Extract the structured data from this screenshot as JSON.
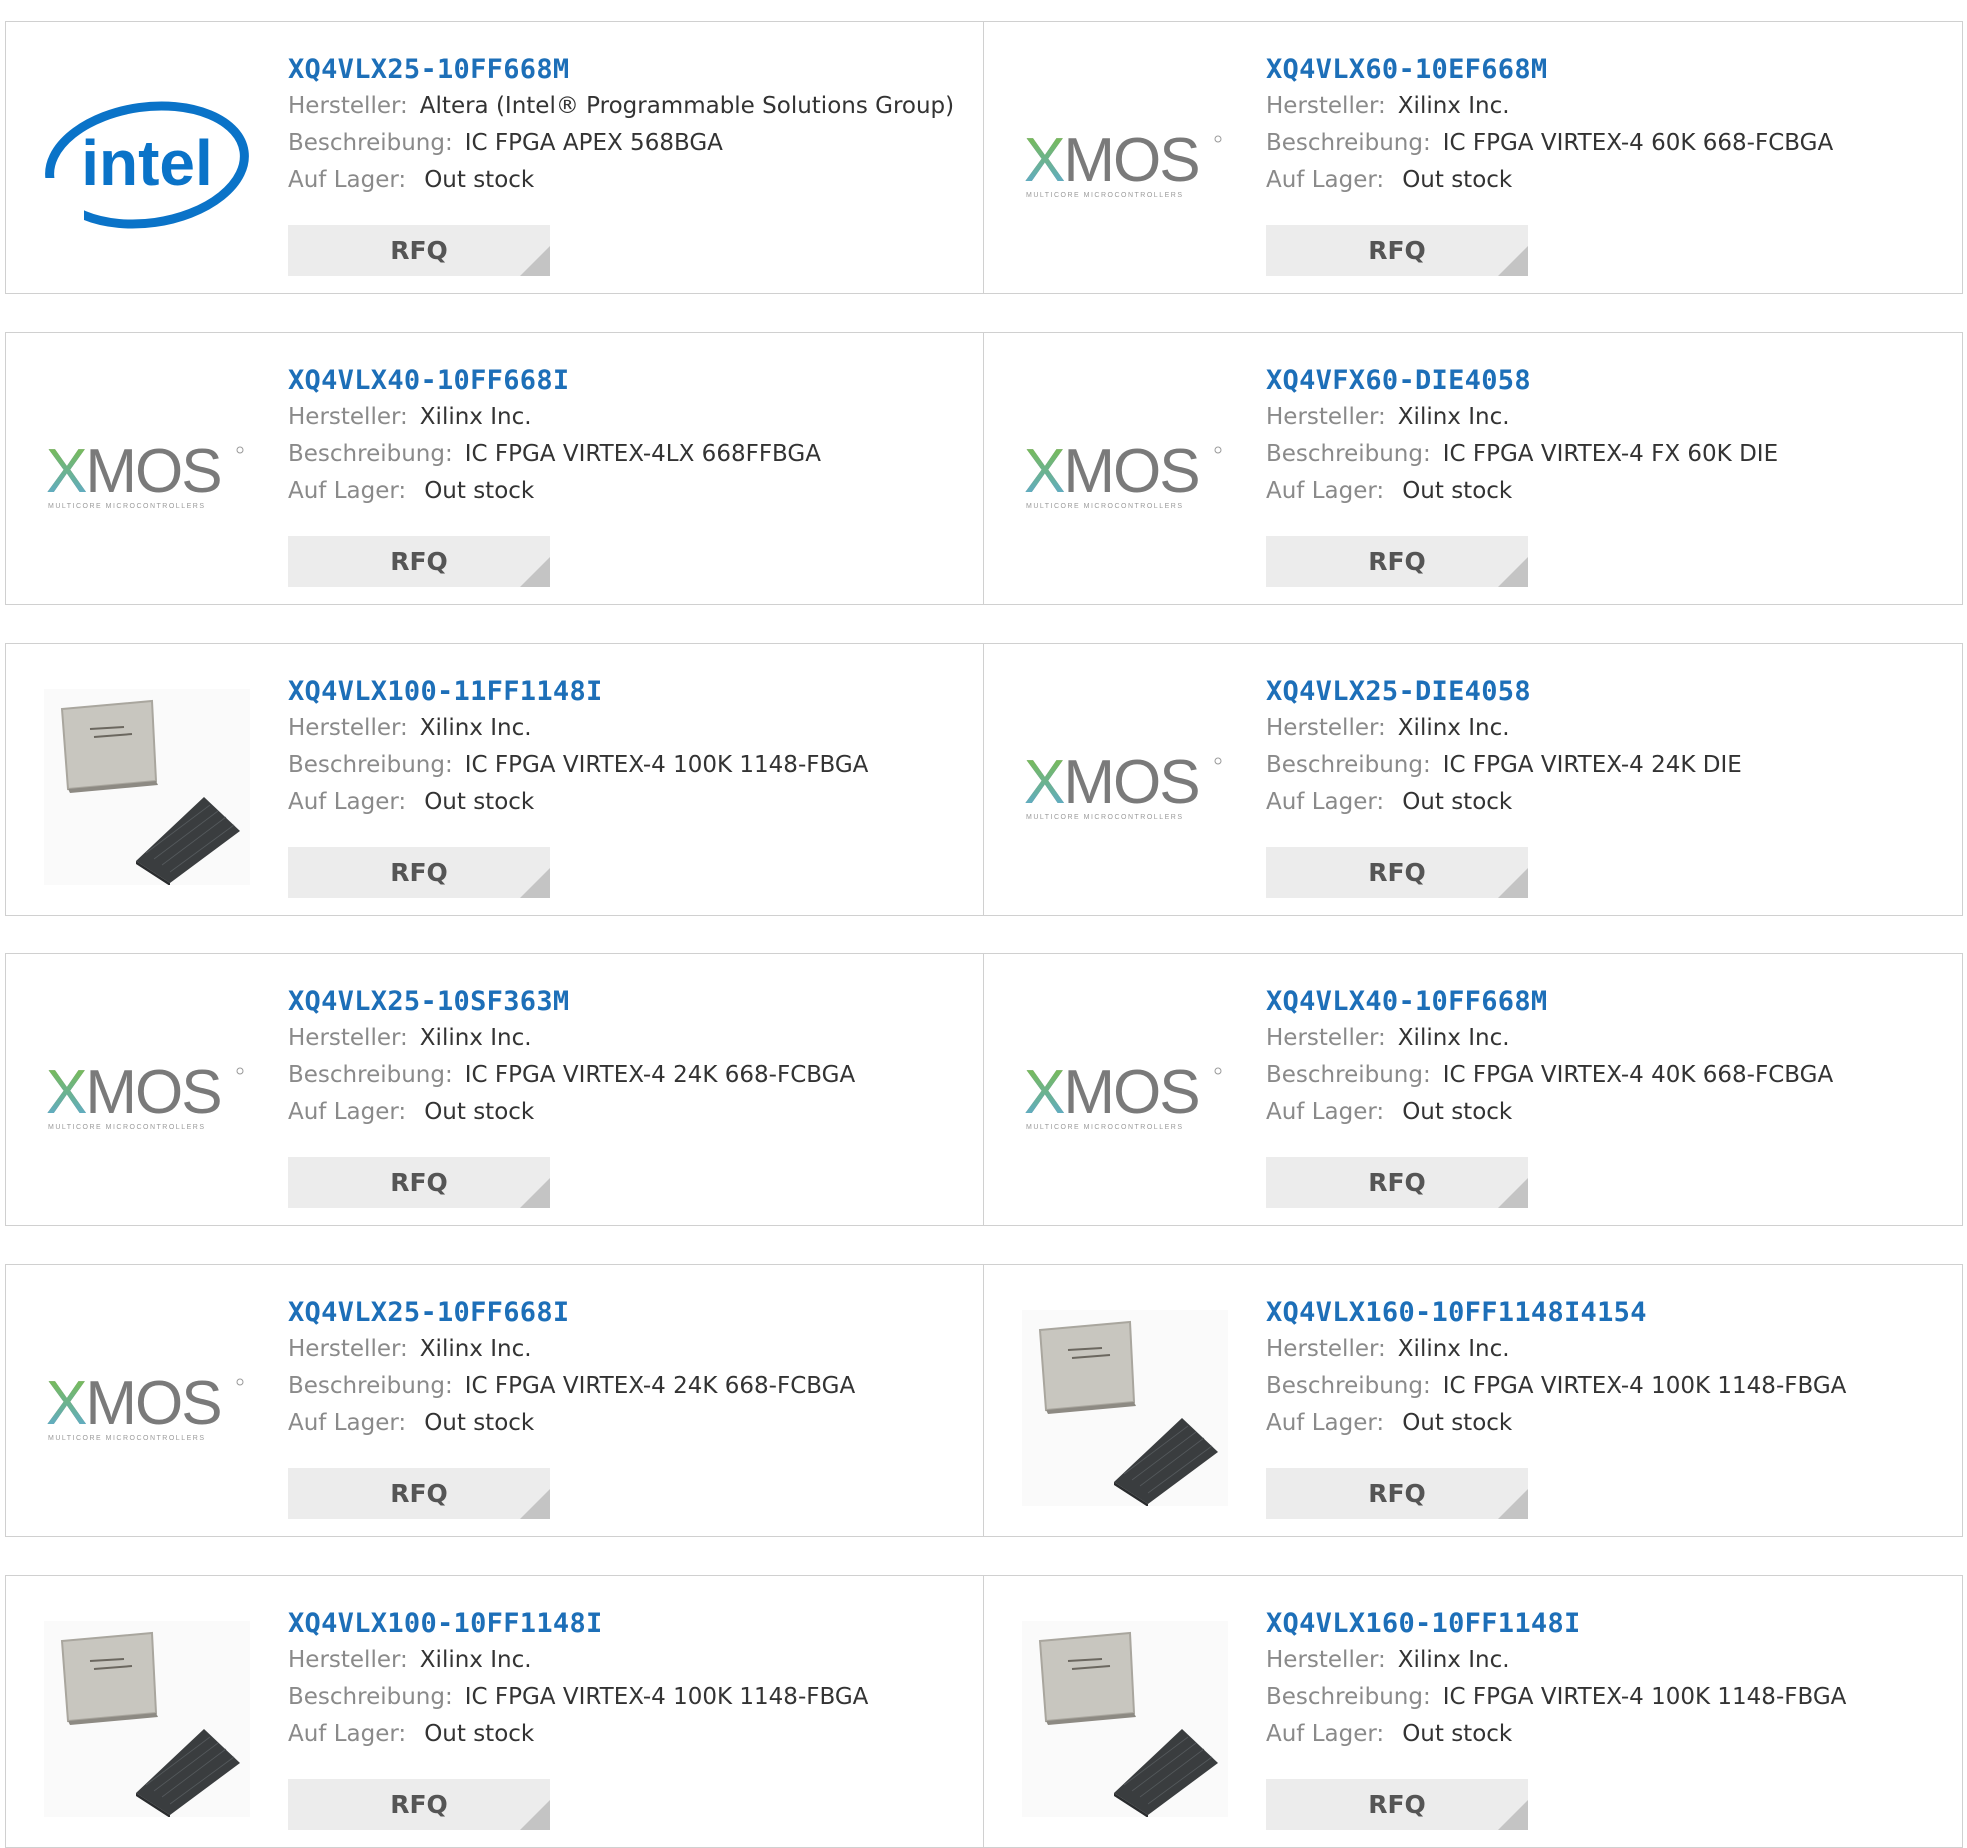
{
  "labels": {
    "manufacturer": "Hersteller:",
    "description": "Beschreibung:",
    "stock": "Auf Lager:",
    "rfq": "RFQ"
  },
  "logo_text": {
    "intel": "intel",
    "xmos": "XMOS",
    "xmos_sub": "MULTICORE MICROCONTROLLERS"
  },
  "colors": {
    "link": "#1d6fb8",
    "rfq_bg": "#ececec",
    "border": "#d0d0d0",
    "intel_blue": "#0a73c8",
    "xmos_green": "#7dbe3f",
    "xmos_blue": "#5aa8e0"
  },
  "products": [
    {
      "part": "XQ4VLX25-10FF668M",
      "manufacturer": "Altera (Intel® Programmable Solutions Group)",
      "description": "IC FPGA APEX 568BGA",
      "stock": "Out stock",
      "image": "intel-logo"
    },
    {
      "part": "XQ4VLX60-10EF668M",
      "manufacturer": "Xilinx Inc.",
      "description": "IC FPGA VIRTEX-4 60K 668-FCBGA",
      "stock": "Out stock",
      "image": "xmos-logo"
    },
    {
      "part": "XQ4VLX40-10FF668I",
      "manufacturer": "Xilinx Inc.",
      "description": "IC FPGA VIRTEX-4LX 668FFBGA",
      "stock": "Out stock",
      "image": "xmos-logo"
    },
    {
      "part": "XQ4VFX60-DIE4058",
      "manufacturer": "Xilinx Inc.",
      "description": "IC FPGA VIRTEX-4 FX 60K DIE",
      "stock": "Out stock",
      "image": "xmos-logo"
    },
    {
      "part": "XQ4VLX100-11FF1148I",
      "manufacturer": "Xilinx Inc.",
      "description": "IC FPGA VIRTEX-4 100K 1148-FBGA",
      "stock": "Out stock",
      "image": "chip-photo"
    },
    {
      "part": "XQ4VLX25-DIE4058",
      "manufacturer": "Xilinx Inc.",
      "description": "IC FPGA VIRTEX-4 24K DIE",
      "stock": "Out stock",
      "image": "xmos-logo"
    },
    {
      "part": "XQ4VLX25-10SF363M",
      "manufacturer": "Xilinx Inc.",
      "description": "IC FPGA VIRTEX-4 24K 668-FCBGA",
      "stock": "Out stock",
      "image": "xmos-logo"
    },
    {
      "part": "XQ4VLX40-10FF668M",
      "manufacturer": "Xilinx Inc.",
      "description": "IC FPGA VIRTEX-4 40K 668-FCBGA",
      "stock": "Out stock",
      "image": "xmos-logo"
    },
    {
      "part": "XQ4VLX25-10FF668I",
      "manufacturer": "Xilinx Inc.",
      "description": "IC FPGA VIRTEX-4 24K 668-FCBGA",
      "stock": "Out stock",
      "image": "xmos-logo"
    },
    {
      "part": "XQ4VLX160-10FF1148I4154",
      "manufacturer": "Xilinx Inc.",
      "description": "IC FPGA VIRTEX-4 100K 1148-FBGA",
      "stock": "Out stock",
      "image": "chip-photo"
    },
    {
      "part": "XQ4VLX100-10FF1148I",
      "manufacturer": "Xilinx Inc.",
      "description": "IC FPGA VIRTEX-4 100K 1148-FBGA",
      "stock": "Out stock",
      "image": "chip-photo"
    },
    {
      "part": "XQ4VLX160-10FF1148I",
      "manufacturer": "Xilinx Inc.",
      "description": "IC FPGA VIRTEX-4 100K 1148-FBGA",
      "stock": "Out stock",
      "image": "chip-photo"
    }
  ]
}
